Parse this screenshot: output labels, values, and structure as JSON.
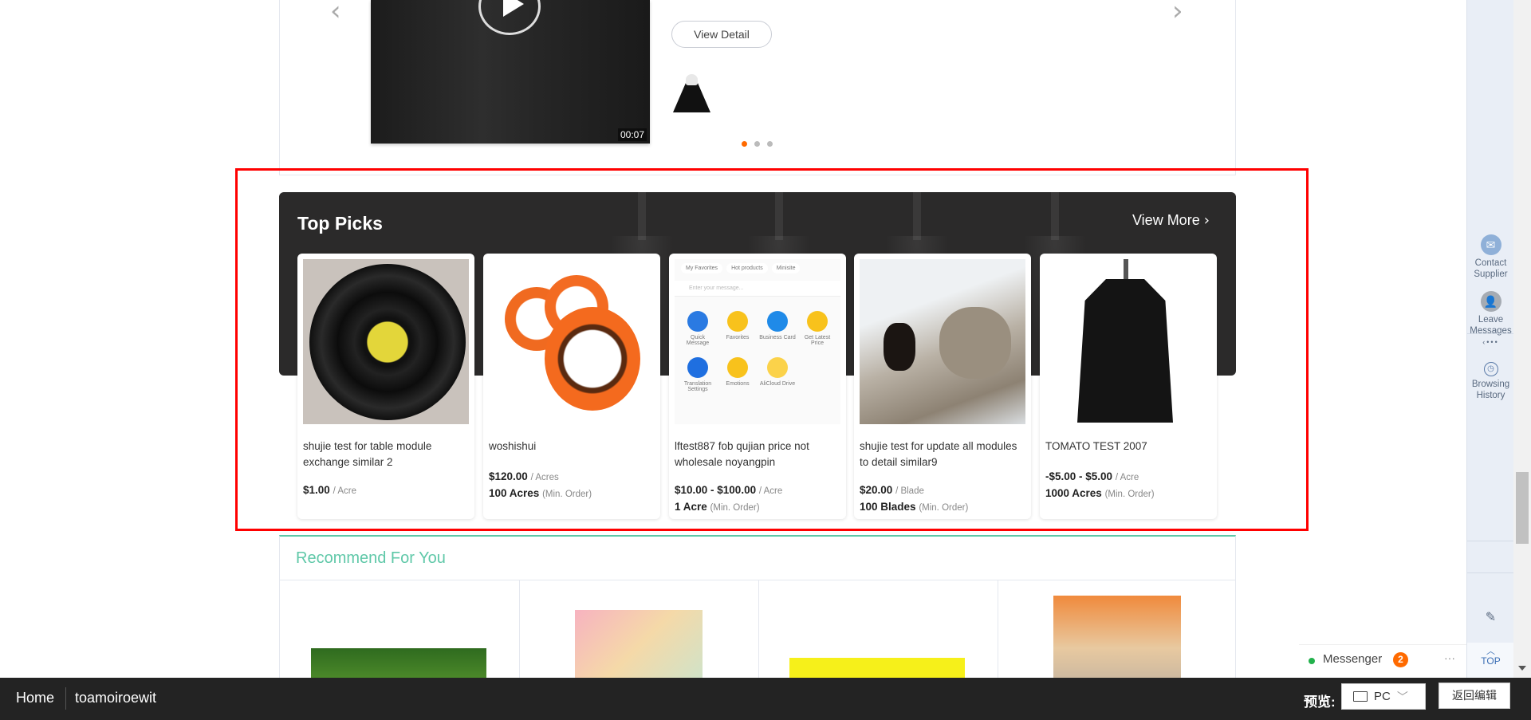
{
  "video": {
    "duration": "00:07",
    "view_detail": "View Detail",
    "carousel_dots": 3,
    "active_dot": 1
  },
  "top_picks": {
    "title": "Top Picks",
    "view_more": "View More",
    "products": [
      {
        "title": "shujie test for table module exchange similar 2",
        "price": "$1.00",
        "unit": "/ Acre",
        "moq": "",
        "moq_label": "",
        "image": "vinyl-record"
      },
      {
        "title": "woshishui",
        "price": "$120.00",
        "unit": "/ Acres",
        "moq": "100 Acres",
        "moq_label": "(Min. Order)",
        "image": "orange-tape-rolls"
      },
      {
        "title": "lftest887 fob qujian price not wholesale noyangpin",
        "price": "$10.00 - $100.00",
        "unit": "/ Acre",
        "moq": "1 Acre",
        "moq_label": "(Min. Order)",
        "image": "app-screenshot",
        "app_tabs": [
          "My Favorites",
          "Hot products",
          "Minisite"
        ],
        "app_placeholder": "Enter your message...",
        "app_icons": [
          "Quick Message",
          "Favorites",
          "Business Card",
          "Get Latest Price",
          "Translation Settings",
          "Emotions",
          "AliCloud Drive"
        ]
      },
      {
        "title": "shujie test for update all modules to detail similar9",
        "price": "$20.00",
        "unit": "/ Blade",
        "moq": "100 Blades",
        "moq_label": "(Min. Order)",
        "image": "cat-selfie"
      },
      {
        "title": "TOMATO TEST 2007",
        "price": "-$5.00 - $5.00",
        "unit": "/ Acre",
        "moq": "1000 Acres",
        "moq_label": "(Min. Order)",
        "image": "black-cape"
      }
    ]
  },
  "recommend": {
    "title": "Recommend For You"
  },
  "sidebar": {
    "items": [
      {
        "label": "Contact Supplier",
        "icon": "mail-icon"
      },
      {
        "label": "Leave Messages",
        "icon": "user-icon"
      },
      {
        "label": "Browsing History",
        "icon": "clock-icon"
      }
    ],
    "top": "TOP"
  },
  "messenger": {
    "label": "Messenger",
    "count": "2",
    "status_color": "#22b14c",
    "badge_color": "#ff6a00"
  },
  "bottom": {
    "home": "Home",
    "site": "toamoiroewit",
    "preview_label": "预览:",
    "device": "PC",
    "back_edit": "返回编辑"
  },
  "colors": {
    "accent": "#ff6a00",
    "recommend": "#5fc8a8",
    "highlight": "#ff0000"
  }
}
